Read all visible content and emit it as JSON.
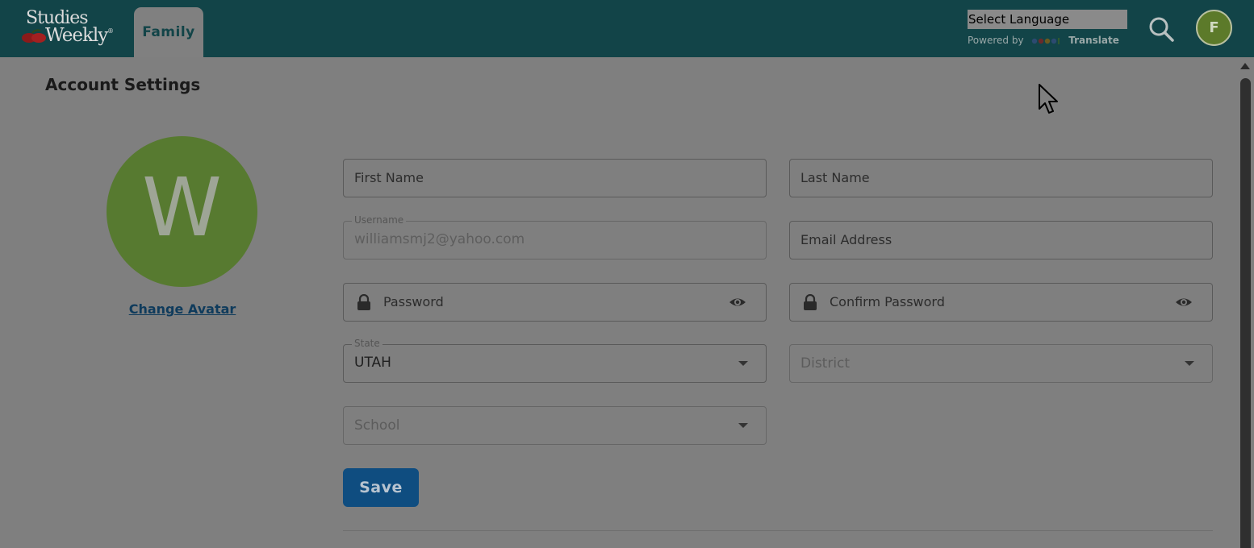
{
  "header": {
    "logo_line1": "Studies",
    "logo_line2": "Weekly",
    "logo_reg": "®",
    "tab_family": "Family",
    "language_select": "Select Language",
    "powered_by": "Powered by",
    "translate": "Translate",
    "user_initial": "F"
  },
  "page": {
    "title": "Account Settings",
    "avatar_letter": "W",
    "change_avatar": "Change Avatar"
  },
  "form": {
    "first_name_placeholder": "First Name",
    "last_name_placeholder": "Last Name",
    "username_label": "Username",
    "username_value": "williamsmj2@yahoo.com",
    "email_placeholder": "Email Address",
    "password_placeholder": "Password",
    "confirm_password_placeholder": "Confirm Password",
    "state_label": "State",
    "state_value": "UTAH",
    "district_placeholder": "District",
    "school_placeholder": "School",
    "save_label": "Save"
  },
  "colors": {
    "header_bg": "#124448",
    "avatar_green": "#577a30",
    "save_blue": "#0f4d80",
    "overlay_gray": "#7f7f7f"
  },
  "icons": [
    "apple-icon",
    "google-logo-icon",
    "search-icon",
    "lock-icon",
    "eye-icon",
    "chevron-down-icon",
    "mouse-cursor-icon"
  ]
}
